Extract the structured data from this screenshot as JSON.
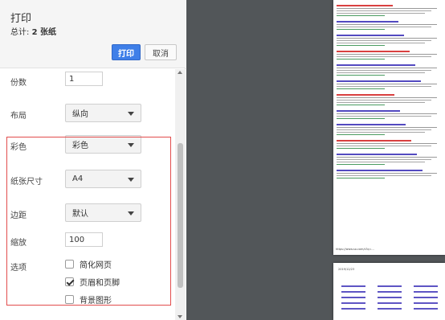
{
  "header": {
    "title": "打印",
    "total_prefix": "总计: ",
    "total_value": "2 张纸",
    "print_label": "打印",
    "cancel_label": "取消"
  },
  "settings": {
    "copies": {
      "label": "份数",
      "value": "1"
    },
    "layout": {
      "label": "布局",
      "value": "纵向"
    },
    "color": {
      "label": "彩色",
      "value": "彩色"
    },
    "paper": {
      "label": "纸张尺寸",
      "value": "A4"
    },
    "margins": {
      "label": "边距",
      "value": "默认"
    },
    "scale": {
      "label": "缩放",
      "value": "100"
    },
    "options": {
      "label": "选项",
      "items": [
        {
          "label": "简化网页",
          "checked": false
        },
        {
          "label": "页眉和页脚",
          "checked": true
        },
        {
          "label": "背景图形",
          "checked": false
        }
      ]
    }
  },
  "preview": {
    "footer_url": "https://www.so.com/s?q=...",
    "page2_date": "2019/12/23"
  },
  "colors": {
    "accent": "#3f7fe8",
    "highlight": "#e24d4d",
    "preview_bg": "#525659",
    "link": "#1a0dab",
    "snippet_green": "#0e7a2b"
  }
}
